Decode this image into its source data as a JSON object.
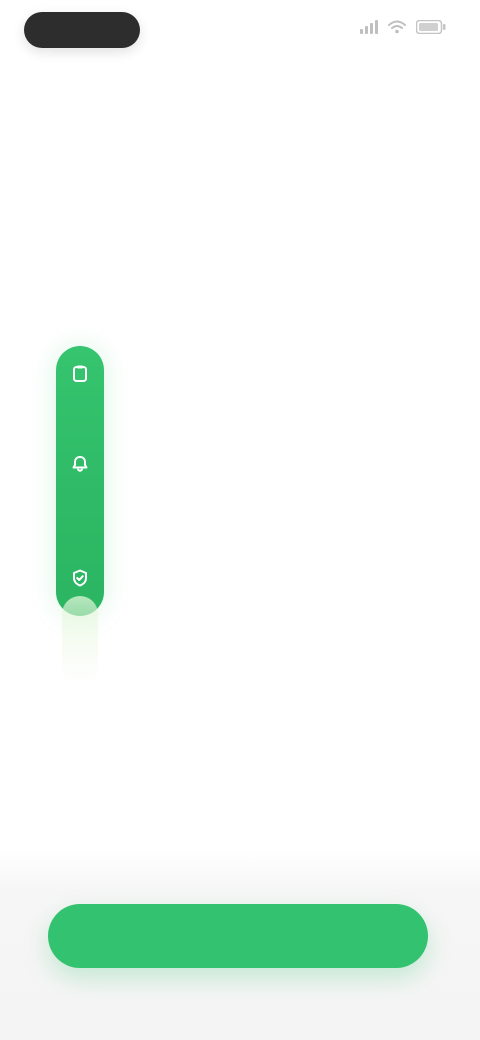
{
  "status_bar": {
    "time": "",
    "icons": [
      "signal-icon",
      "wifi-icon",
      "battery-icon"
    ]
  },
  "main": {
    "title_line_1": "",
    "title_line_2": "",
    "steps": [
      {
        "title": "",
        "description": ""
      },
      {
        "title": "",
        "description": ""
      },
      {
        "title": "",
        "description": ""
      }
    ]
  },
  "footer": {
    "note": "",
    "cta_label": ""
  },
  "colors": {
    "accent": "#33C26F",
    "accent_dark": "#2BB562",
    "background": "#FFFFFF",
    "footer_background": "#F4F4F4",
    "text_primary": "#1B1B1B",
    "text_secondary": "#8B8B8B"
  }
}
